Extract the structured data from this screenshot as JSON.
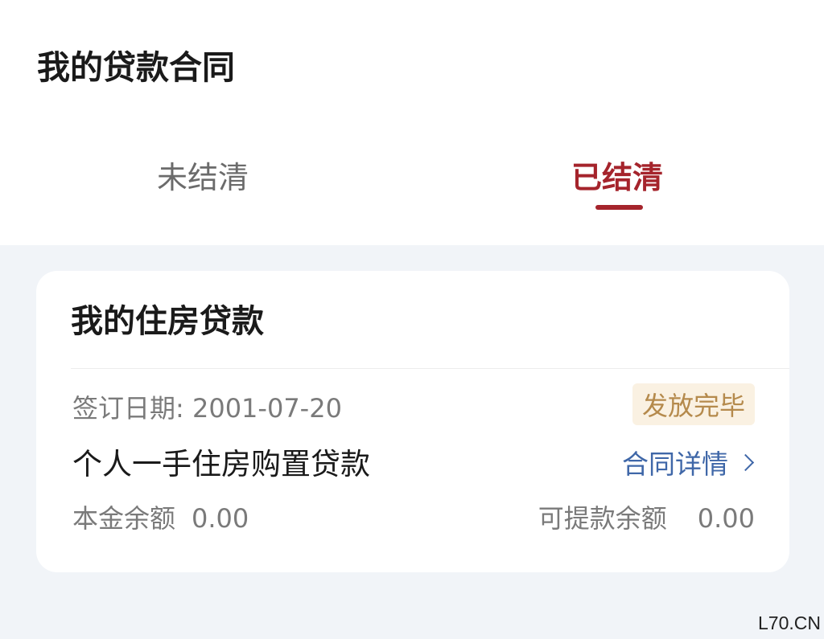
{
  "header": {
    "title": "我的贷款合同"
  },
  "tabs": [
    {
      "label": "未结清",
      "active": false
    },
    {
      "label": "已结清",
      "active": true
    }
  ],
  "card": {
    "title": "我的住房贷款",
    "sign_date_label": "签订日期:",
    "sign_date_value": "2001-07-20",
    "status": "发放完毕",
    "loan_type": "个人一手住房购置贷款",
    "detail_link_label": "合同详情",
    "principal_label": "本金余额",
    "principal_value": "0.00",
    "withdrawable_label": "可提款余额",
    "withdrawable_value": "0.00"
  },
  "watermark": "L70.CN",
  "colors": {
    "accent": "#a5242c",
    "link": "#3f67a8",
    "badge_text": "#b58a4c",
    "badge_bg": "#faf1e2",
    "page_bg": "#f1f4f8"
  },
  "icons": {
    "detail_link_icon": "chevron-right-icon"
  }
}
